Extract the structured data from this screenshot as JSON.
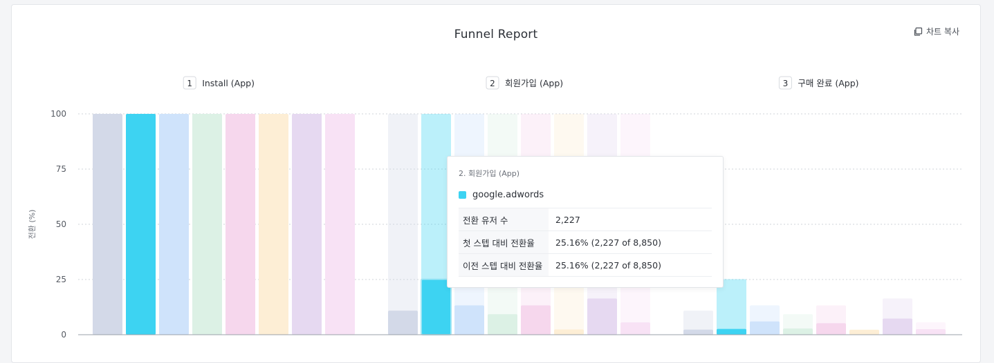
{
  "header": {
    "title": "Funnel Report",
    "copy_label": "차트 복사",
    "copy_icon": "copy-icon"
  },
  "chart_data": {
    "type": "bar",
    "title": "Funnel Report",
    "ylabel": "전환 (%)",
    "xlabel": "",
    "ylim": [
      0,
      100
    ],
    "yticks": [
      0,
      25,
      50,
      75,
      100
    ],
    "grid": true,
    "steps": [
      {
        "index": "1",
        "name": "Install (App)"
      },
      {
        "index": "2",
        "name": "회원가입 (App)"
      },
      {
        "index": "3",
        "name": "구매 완료 (App)"
      }
    ],
    "series": [
      {
        "color": "#d3d9e8",
        "values": [
          100,
          10.9,
          2.3
        ]
      },
      {
        "color": "#3dd3f2",
        "values": [
          100,
          25.16,
          2.6
        ]
      },
      {
        "color": "#cfe3fb",
        "values": [
          100,
          13.3,
          6.0
        ]
      },
      {
        "color": "#dcf1e5",
        "values": [
          100,
          9.3,
          2.8
        ]
      },
      {
        "color": "#f6d7ed",
        "values": [
          100,
          13.3,
          5.2
        ]
      },
      {
        "color": "#fdeed5",
        "values": [
          100,
          2.4,
          2.2
        ]
      },
      {
        "color": "#e6d9f1",
        "values": [
          100,
          16.4,
          7.3
        ]
      },
      {
        "color": "#f8e2f5",
        "values": [
          100,
          5.6,
          2.5
        ]
      }
    ],
    "active_series_index": 1,
    "active_step_index": 1
  },
  "tooltip": {
    "step_label": "2. 회원가입 (App)",
    "series_name": "google.adwords",
    "series_color": "#3dd3f2",
    "rows": [
      {
        "label": "전환 유저 수",
        "value": "2,227"
      },
      {
        "label": "첫 스텝 대비 전환율",
        "value": "25.16% (2,227 of 8,850)"
      },
      {
        "label": "이전 스텝 대비 전환율",
        "value": "25.16% (2,227 of 8,850)"
      }
    ]
  }
}
